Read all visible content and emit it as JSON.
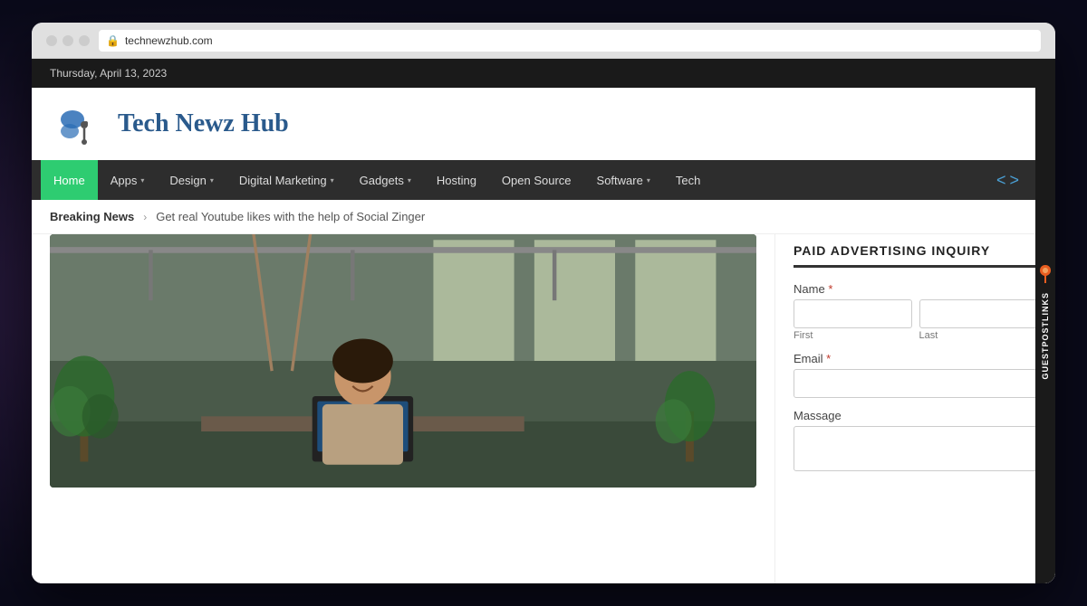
{
  "browser": {
    "url": "technewzhub.com",
    "lock_icon": "🔒"
  },
  "topbar": {
    "date": "Thursday, April 13, 2023"
  },
  "site": {
    "name": "Tech Newz Hub",
    "logo_alt": "Tech Newz Hub Logo"
  },
  "nav": {
    "items": [
      {
        "label": "Home",
        "active": true,
        "has_arrow": false
      },
      {
        "label": "Apps",
        "active": false,
        "has_arrow": true
      },
      {
        "label": "Design",
        "active": false,
        "has_arrow": true
      },
      {
        "label": "Digital Marketing",
        "active": false,
        "has_arrow": true
      },
      {
        "label": "Gadgets",
        "active": false,
        "has_arrow": true
      },
      {
        "label": "Hosting",
        "active": false,
        "has_arrow": false
      },
      {
        "label": "Open Source",
        "active": false,
        "has_arrow": false
      },
      {
        "label": "Software",
        "active": false,
        "has_arrow": true
      },
      {
        "label": "Tech",
        "active": false,
        "has_arrow": false
      }
    ],
    "prev_icon": "<",
    "next_icon": ">"
  },
  "breaking_news": {
    "label": "Breaking News",
    "text": "Get real Youtube likes with the help of Social Zinger"
  },
  "sidebar": {
    "widget_title": "PAID ADVERTISING INQUIRY",
    "form": {
      "name_label": "Name",
      "name_required": "*",
      "first_label": "First",
      "last_label": "Last",
      "email_label": "Email",
      "email_required": "*",
      "massage_label": "Massage"
    }
  },
  "side_decoration": {
    "text": "GUESTPOSTLINKS"
  }
}
